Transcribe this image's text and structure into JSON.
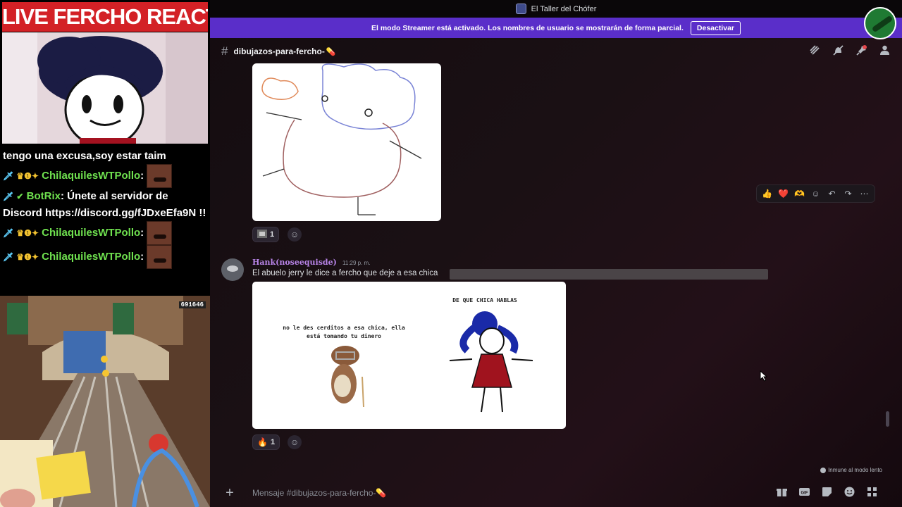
{
  "overlay": {
    "stream_title": "LIVE FERCHO REACTION",
    "chat": [
      {
        "text": "tengo una excusa,soy estar taim"
      },
      {
        "user": "ChilaquilesWTPollo",
        "suffix": ":"
      },
      {
        "user": "BotRix",
        "message": ": Únete al servidor de Discord https://discord.gg/fJDxeEfa9N !!"
      },
      {
        "user": "ChilaquilesWTPollo",
        "suffix": ":"
      },
      {
        "user": "ChilaquilesWTPollo",
        "suffix": ":"
      }
    ],
    "game_score": "691646"
  },
  "titlebar": {
    "title": "El Taller del Chófer"
  },
  "streamer_banner": {
    "text": "El modo Streamer está activado. Los nombres de usuario se mostrarán de forma parcial.",
    "button": "Desactivar"
  },
  "channel": {
    "hash": "#",
    "name": "dibujazos-para-fercho-",
    "emoji": "💊"
  },
  "header_icons": [
    "threads-icon",
    "mute-icon",
    "pin-icon",
    "members-icon"
  ],
  "messages": [
    {
      "reactions": [
        {
          "icon": "sticker-emoji",
          "count": "1"
        }
      ]
    },
    {
      "username": "Hank(noseequisde)",
      "time": "11:29 p. m.",
      "text": "El abuelo jerry le dice a fercho que deje a esa chica",
      "meme_caption_left": "no le des cerditos a esa chica, ella está tomando tu dinero",
      "meme_caption_right": "DE QUE CHICA HABLAS",
      "reactions": [
        {
          "icon": "🔥",
          "count": "1"
        }
      ]
    }
  ],
  "message_actions": [
    "👍",
    "❤️",
    "🫶",
    "add-reaction-icon",
    "reply-icon",
    "forward-icon",
    "more-icon"
  ],
  "slow_mode": "Inmune al modo lento",
  "composer": {
    "placeholder": "Mensaje #dibujazos-para-fercho-💊",
    "plus": "+"
  },
  "colors": {
    "banner": "#5a2ec9",
    "stream_title_bg": "#d32126",
    "chat_user": "#6fe14f",
    "username": "#b884e8"
  }
}
